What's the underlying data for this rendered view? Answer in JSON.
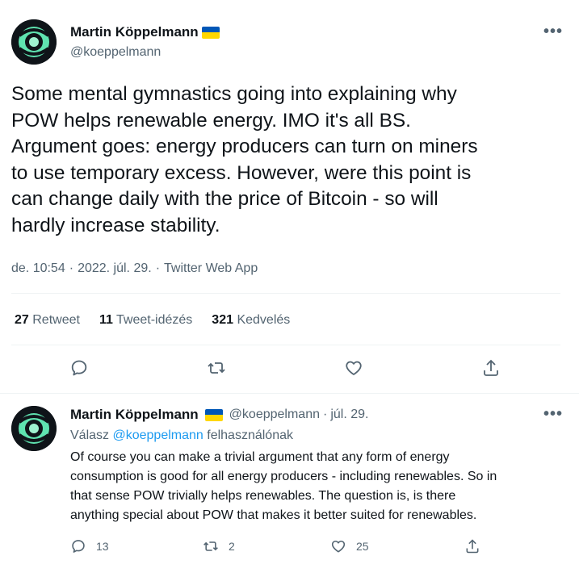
{
  "main_tweet": {
    "author_name": "Martin Köppelmann",
    "author_handle": "@koeppelmann",
    "text": "Some mental gymnastics going into explaining why POW helps renewable energy. IMO it's all BS. Argument goes: energy producers can turn on miners to use temporary excess. However, were this point is can change daily with the price of Bitcoin - so will hardly increase stability.",
    "lines": [
      "Some mental gymnastics going into explaining why",
      "POW helps renewable energy. IMO it's all BS.",
      "Argument goes: energy producers can turn on miners",
      "to use temporary excess. However, were this point is",
      "can change daily with the price of Bitcoin - so will",
      "hardly increase stability."
    ],
    "time": "de. 10:54",
    "date": "2022. júl. 29.",
    "source": "Twitter Web App",
    "separator": "·",
    "stats": {
      "retweets_count": "27",
      "retweets_label": "Retweet",
      "quotes_count": "11",
      "quotes_label": "Tweet-idézés",
      "likes_count": "321",
      "likes_label": "Kedvelés"
    }
  },
  "reply": {
    "author_name": "Martin Köppelmann",
    "author_handle": "@koeppelmann",
    "dot": "·",
    "date": "júl. 29.",
    "reply_prefix": "Válasz",
    "reply_to": "@koeppelmann",
    "reply_suffix": "felhasználónak",
    "lines": [
      "Of course you can make a trivial argument that any form of energy",
      "consumption is good for all energy producers - including renewables. So in",
      "that sense POW trivially helps renewables. The question is, is there",
      "anything special about POW that makes it better suited for renewables."
    ],
    "reply_count": "13",
    "retweet_count": "2",
    "like_count": "25"
  },
  "more_label": "•••",
  "colors": {
    "text": "#0f1419",
    "secondary": "#536471",
    "link": "#1d9bf0",
    "divider": "#eff3f4",
    "flag_blue": "#0057b7",
    "flag_yellow": "#ffd700"
  }
}
